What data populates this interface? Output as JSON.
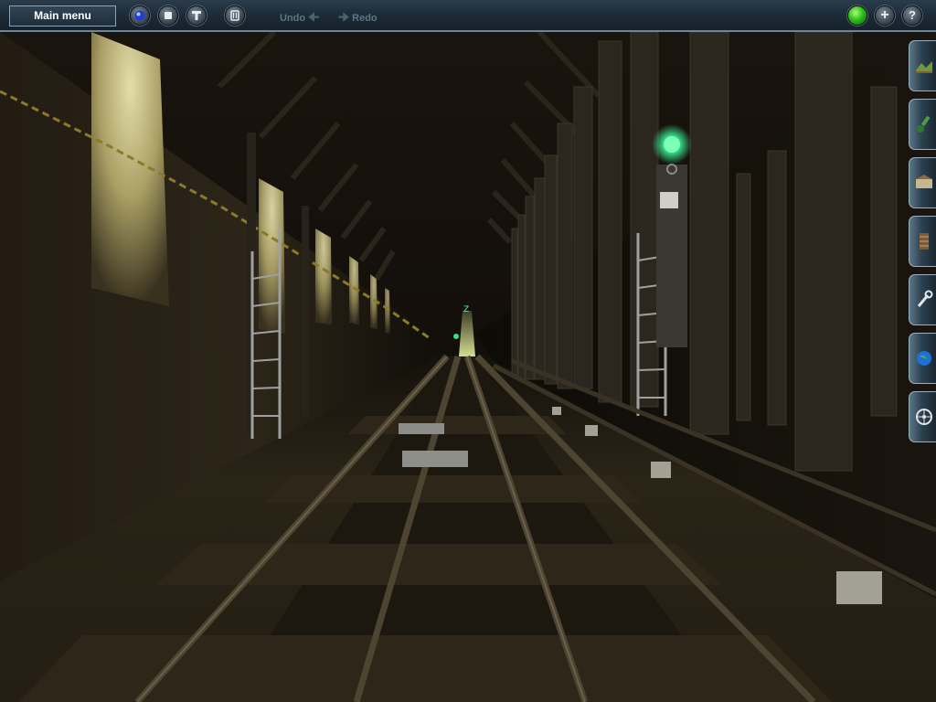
{
  "toolbar": {
    "main_menu_label": "Main menu",
    "undo_label": "Undo",
    "redo_label": "Redo",
    "undo_icon": "arrow-left-icon",
    "redo_icon": "arrow-right-icon",
    "buttons": [
      {
        "name": "blue-globe-icon"
      },
      {
        "name": "stop-icon"
      },
      {
        "name": "tools-icon"
      },
      {
        "name": "trash-icon"
      }
    ],
    "right_buttons": [
      {
        "name": "status-light-icon",
        "color": "#2fbf1c"
      },
      {
        "name": "plus-icon"
      },
      {
        "name": "help-icon"
      }
    ]
  },
  "side_palette": {
    "tabs": [
      {
        "name": "terrain-tool-icon"
      },
      {
        "name": "paint-tool-icon"
      },
      {
        "name": "objects-tool-icon"
      },
      {
        "name": "track-tool-icon"
      },
      {
        "name": "wrench-tool-icon"
      },
      {
        "name": "globe-tool-icon"
      },
      {
        "name": "settings-wheel-icon"
      }
    ]
  },
  "scene": {
    "description_visible": "",
    "signal_color": "#35e08a",
    "lamp_color": "#e8e2a0"
  },
  "colors": {
    "toolbar_bg": "#1c2a36",
    "toolbar_border": "#6f8594",
    "accent": "#8ea3b3"
  }
}
